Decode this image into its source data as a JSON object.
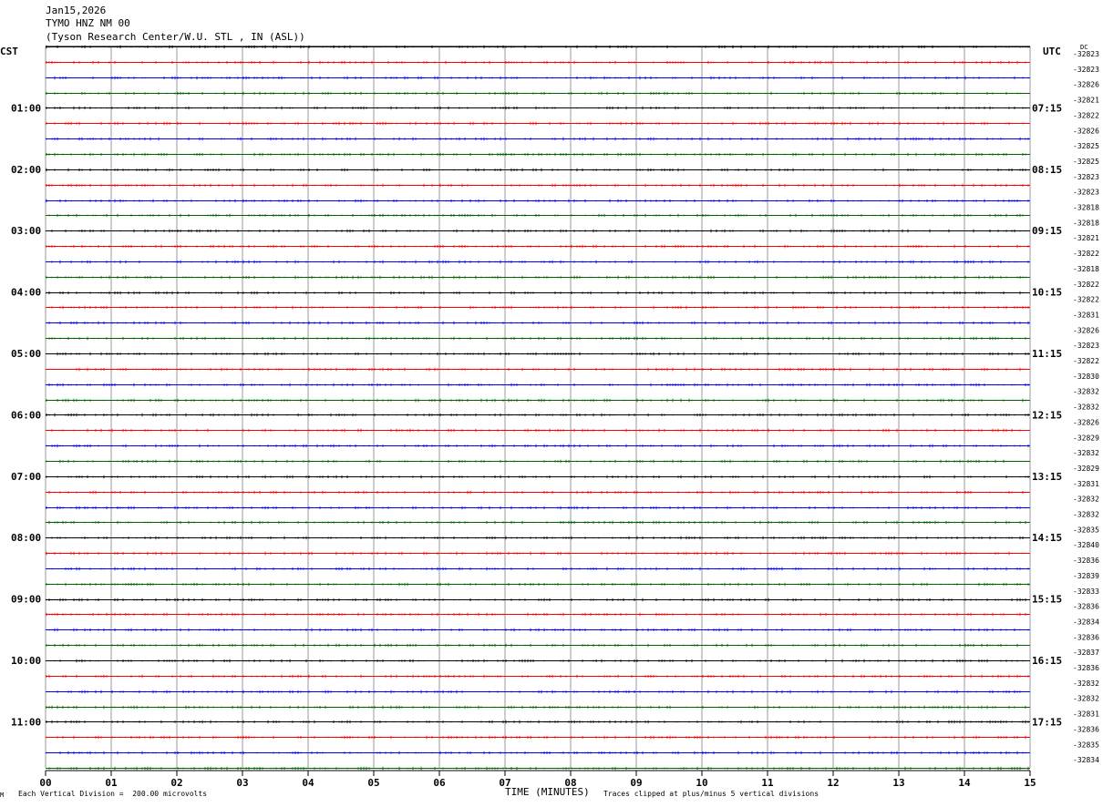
{
  "header": {
    "date": "Jan15,2026",
    "station": "TYMO HNZ NM 00",
    "location": "(Tyson Research Center/W.U. STL , IN (ASL))"
  },
  "left_tz_label": "CST",
  "right_tz_label": "UTC",
  "dc_label": "DC",
  "footer": {
    "corner_mark": "M",
    "scale_note": "Each Vertical Division =  200.00 microvolts",
    "clip_note": "Traces clipped at plus/minus 5 vertical divisions"
  },
  "chart_data": {
    "type": "line",
    "xlabel": "TIME (MINUTES)",
    "x_range": [
      0,
      15
    ],
    "x_ticks": [
      "00",
      "01",
      "02",
      "03",
      "04",
      "05",
      "06",
      "07",
      "08",
      "09",
      "10",
      "11",
      "12",
      "13",
      "14",
      "15"
    ],
    "rows_per_hour": 4,
    "row_colors": [
      "#000000",
      "#ff0000",
      "#0000ff",
      "#006400"
    ],
    "grid": true,
    "left_hour_labels": [
      "01:00",
      "02:00",
      "03:00",
      "04:00",
      "05:00",
      "06:00",
      "07:00",
      "08:00",
      "09:00",
      "10:00",
      "11:00"
    ],
    "right_hour_labels": [
      "07:15",
      "08:15",
      "09:15",
      "10:15",
      "11:15",
      "12:15",
      "13:15",
      "14:15",
      "15:15",
      "16:15",
      "17:15"
    ],
    "dc_offsets": [
      "-32823",
      "-32823",
      "-32826",
      "-32821",
      "-32822",
      "-32826",
      "-32825",
      "-32825",
      "-32823",
      "-32823",
      "-32818",
      "-32818",
      "-32821",
      "-32822",
      "-32818",
      "-32822",
      "-32822",
      "-32831",
      "-32826",
      "-32823",
      "-32822",
      "-32830",
      "-32832",
      "-32832",
      "-32826",
      "-32829",
      "-32832",
      "-32829",
      "-32831",
      "-32832",
      "-32832",
      "-32835",
      "-32840",
      "-32836",
      "-32839",
      "-32833",
      "-32836",
      "-32834",
      "-32836",
      "-32837",
      "-32836",
      "-32832",
      "-32832",
      "-32831",
      "-32836",
      "-32835",
      "-32834"
    ]
  }
}
